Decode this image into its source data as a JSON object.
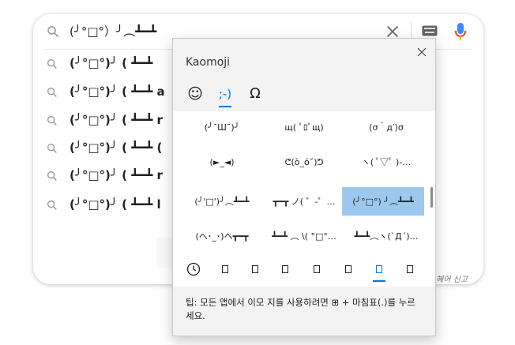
{
  "search": {
    "query": "(╯°□°）╯︵┻━┻",
    "suggestions": [
      "(╯°□°)╯ ( ┻━┻",
      "(╯°□°)╯ ( ┻━┻ a",
      "(╯°□°)╯ ( ┻━┻ r",
      "(╯°□°)╯ ( ┻━┻ (",
      "(╯°□°)╯ ( ┻━┻ r",
      "(╯°□°)╯ ( ┻━┻ l"
    ],
    "report_label": "혜어 신고"
  },
  "panel": {
    "title": "Kaomoji",
    "tabs": [
      "☺",
      ";-)",
      "Ω"
    ],
    "kaomoji": [
      "(╯¯Ш¯)╯",
      "щ( ﾟﾛﾟщ)",
      "(σ｀д′)σ",
      "(►_◄)",
      "ᕦ(ò_óˇ)ᕤ",
      "ヽ( ﾟ▽ﾟ )-…",
      "(╯'□')╯︵┻━┻",
      "┳━┳ ノ( ゜-゜…",
      "(╯°□°) ╯︵┻━┻",
      "(ヘ･_･)ヘ┳━┳",
      "┻━┻ ︵ \\( °□°…",
      "┻━┻︵ヽ(`Д´)…"
    ],
    "selected_index": 8,
    "tip": "팁: 모든 앱에서 이모 지를 사용하려면  ⊞  + 마침표(.)를 누르세요."
  },
  "colors": {
    "accent": "#0078d4",
    "selected": "#9cc8ee",
    "mic": "#4285f4"
  }
}
